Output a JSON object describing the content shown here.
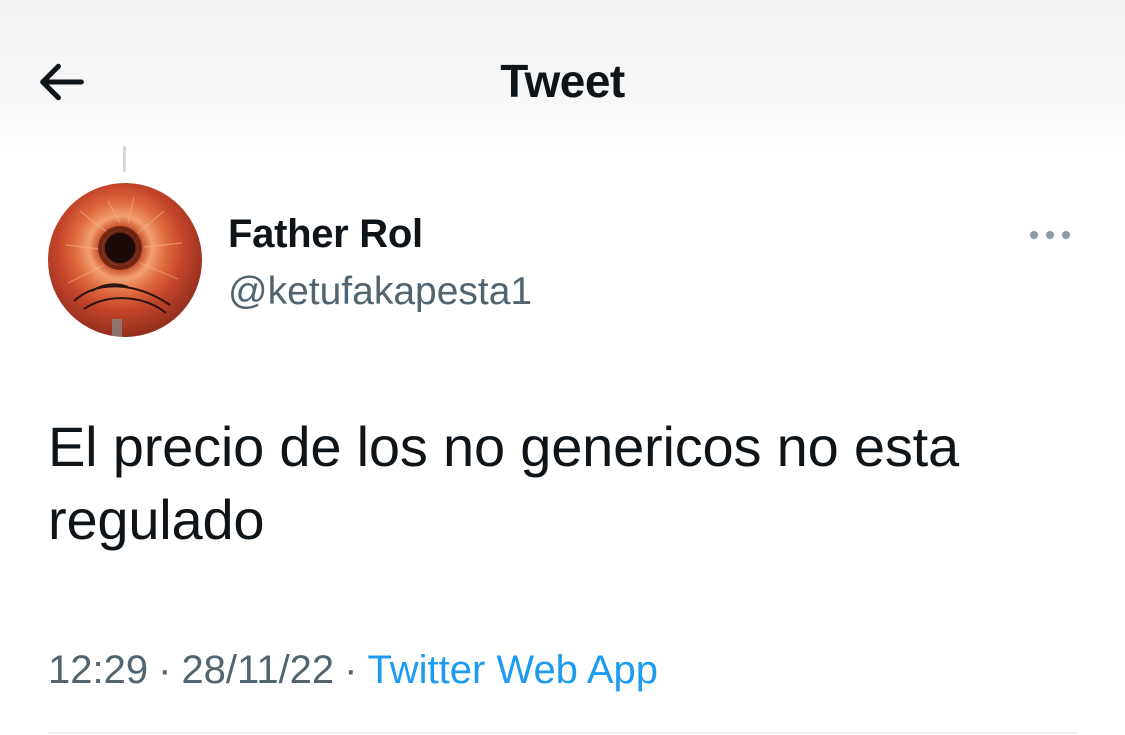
{
  "header": {
    "title": "Tweet",
    "back_icon": "arrow-left-icon"
  },
  "tweet": {
    "author": {
      "display_name": "Father Rol",
      "handle": "@ketufakapesta1",
      "avatar": "eye-avatar"
    },
    "more_icon": "ellipsis-icon",
    "text": "El precio de los no genericos no esta regulado",
    "time": "12:29",
    "separator": "·",
    "date": "28/11/22",
    "source": "Twitter Web App"
  },
  "colors": {
    "text_primary": "#0f1419",
    "text_secondary": "#536471",
    "link": "#1d9bf0",
    "divider": "#eff3f4"
  }
}
